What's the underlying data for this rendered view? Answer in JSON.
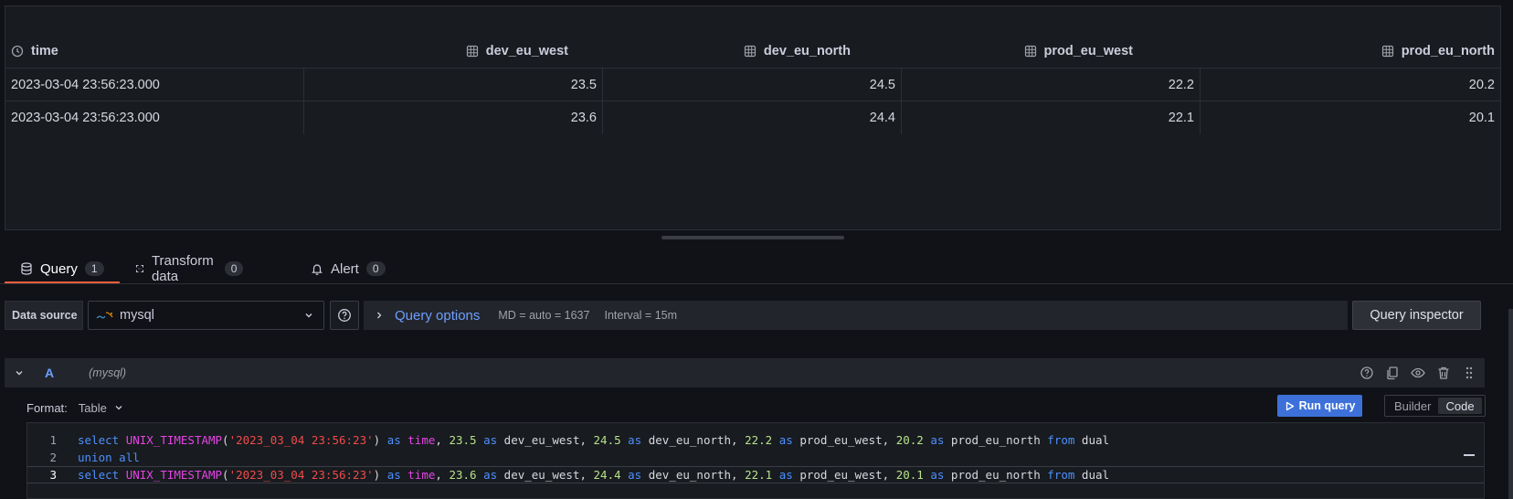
{
  "table": {
    "columns": [
      {
        "label": "time",
        "icon": "clock-icon"
      },
      {
        "label": "dev_eu_west",
        "icon": "table-column-icon"
      },
      {
        "label": "dev_eu_north",
        "icon": "table-column-icon"
      },
      {
        "label": "prod_eu_west",
        "icon": "table-column-icon"
      },
      {
        "label": "prod_eu_north",
        "icon": "table-column-icon"
      }
    ],
    "rows": [
      [
        "2023-03-04 23:56:23.000",
        "23.5",
        "24.5",
        "22.2",
        "20.2"
      ],
      [
        "2023-03-04 23:56:23.000",
        "23.6",
        "24.4",
        "22.1",
        "20.1"
      ]
    ]
  },
  "tabs": [
    {
      "label": "Query",
      "count": "1",
      "icon": "database-icon",
      "active": true
    },
    {
      "label": "Transform data",
      "count": "0",
      "icon": "transform-icon",
      "active": false
    },
    {
      "label": "Alert",
      "count": "0",
      "icon": "bell-icon",
      "active": false
    }
  ],
  "datasource": {
    "label": "Data source",
    "selected": "mysql"
  },
  "query_options": {
    "title": "Query options",
    "md": "MD = auto = 1637",
    "interval": "Interval = 15m"
  },
  "query_inspector_label": "Query inspector",
  "query_row": {
    "letter": "A",
    "datasource": "(mysql)"
  },
  "format": {
    "label": "Format:",
    "value": "Table"
  },
  "run_query_label": "Run query",
  "editor_mode": {
    "builder": "Builder",
    "code": "Code",
    "active": "Code"
  },
  "code_lines": [
    "select UNIX_TIMESTAMP('2023_03_04 23:56:23') as time, 23.5 as dev_eu_west, 24.5 as dev_eu_north, 22.2 as prod_eu_west, 20.2 as prod_eu_north from dual",
    "union all",
    "select UNIX_TIMESTAMP('2023_03_04 23:56:23') as time, 23.6 as dev_eu_west, 24.4 as dev_eu_north, 22.1 as prod_eu_west, 20.1 as prod_eu_north from dual"
  ],
  "colors": {
    "accent": "#6e9fff",
    "tab_underline": "#f55f3e",
    "run_button": "#3d71d9",
    "keyword": "#4d90ff",
    "function": "#e544e5",
    "string": "#f14a4a",
    "number": "#b6e28a"
  }
}
